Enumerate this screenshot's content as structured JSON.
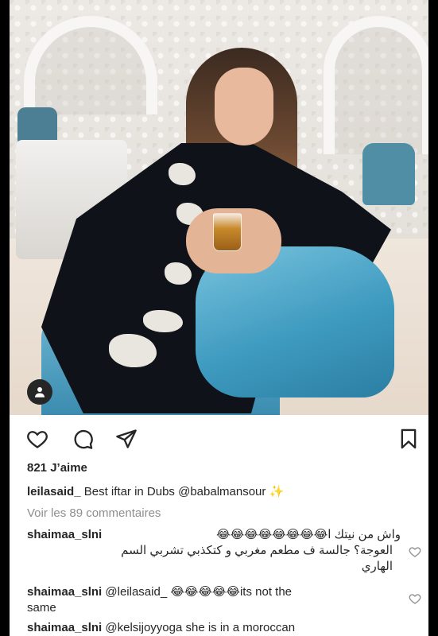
{
  "post": {
    "likes_label": "821 J’aime",
    "caption": {
      "username": "leilasaid_",
      "text": "Best iftar in Dubs @babalmansour",
      "emoji": "✨"
    },
    "view_comments": "Voir les 89 commentaires"
  },
  "comments": [
    {
      "username": "shaimaa_slni",
      "line1": "واش من نيتك ا😂😂😂😂😂😂😂😂",
      "line2": "العوجة؟ جالسة ف مطعم مغربي و كتكذبي تشربي السم",
      "line3": "الهاري"
    },
    {
      "username": "shaimaa_slni",
      "text": "@leilasaid_ 😂😂😂😂😂its not the",
      "text2": "same"
    },
    {
      "username": "shaimaa_slni",
      "text": "@kelsijoyyoga she is in a moroccan"
    }
  ],
  "icons": {
    "like": "heart-icon",
    "comment": "comment-bubble-icon",
    "share": "paper-plane-icon",
    "save": "bookmark-icon",
    "tag": "person-tag-icon"
  },
  "colors": {
    "text": "#262626",
    "muted": "#8e8e8e",
    "background": "#ffffff",
    "sofa": "#4f9fc3"
  }
}
